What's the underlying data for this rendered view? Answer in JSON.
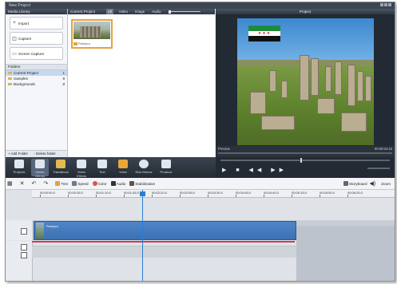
{
  "window": {
    "title": "New Project"
  },
  "library": {
    "header": "Media Library",
    "buttons": [
      {
        "label": "Import",
        "icon": "plus-icon"
      },
      {
        "label": "Capture",
        "icon": "capture-icon"
      },
      {
        "label": "Screen Capture",
        "icon": "monitor-icon"
      }
    ],
    "folders_header": "Folders",
    "folders": [
      {
        "name": "Current Project",
        "count": "1"
      },
      {
        "name": "Samples",
        "count": "8"
      },
      {
        "name": "Backgrounds",
        "count": "8"
      }
    ],
    "footer": {
      "add": "+ Add Folder",
      "delete": "- Delete folder"
    }
  },
  "project": {
    "header": "Current Project",
    "filters": [
      "All",
      "Video",
      "Image",
      "Audio"
    ],
    "clip_caption": "Palmyra"
  },
  "preview": {
    "header": "Project",
    "label": "Preview",
    "time": "00:00:04:15"
  },
  "ribbon": [
    {
      "label": "Projects",
      "icon": "projects-icon"
    },
    {
      "label": "Media Library",
      "icon": "media-library-icon"
    },
    {
      "label": "Transitions",
      "icon": "transitions-icon"
    },
    {
      "label": "Video Effects",
      "icon": "video-effects-icon"
    },
    {
      "label": "Text",
      "icon": "text-icon"
    },
    {
      "label": "Voice",
      "icon": "voice-icon"
    },
    {
      "label": "Disc Menus",
      "icon": "disc-menus-icon"
    },
    {
      "label": "Produce",
      "icon": "produce-icon"
    }
  ],
  "playback": {
    "controls": "▶ ■ ◀◀ ▶▶"
  },
  "edit_toolbar": {
    "trim": "Trim",
    "speed": "Speed",
    "color": "Color",
    "audio": "Audio",
    "stabilization": "Stabilization",
    "storyboard": "Storyboard",
    "zoom": "Zoom"
  },
  "timeline": {
    "ticks": [
      "00:00:00.0",
      "00:00:35.0",
      "00:01:10.0",
      "00:01:45.0",
      "00:02:20.0",
      "00:02:55.0",
      "00:03:30.0",
      "00:04:05.0",
      "00:04:40.0",
      "00:05:15.0",
      "00:05:50.0",
      "00:06:25.0"
    ],
    "clip_label": "Palmyra"
  },
  "colors": {
    "accent": "#2d7dd2",
    "clip": "#3c71b2",
    "audio_line": "#d23a4d",
    "flag_green": "#1f8b3a",
    "flag_red_star": "#d01f2b"
  }
}
